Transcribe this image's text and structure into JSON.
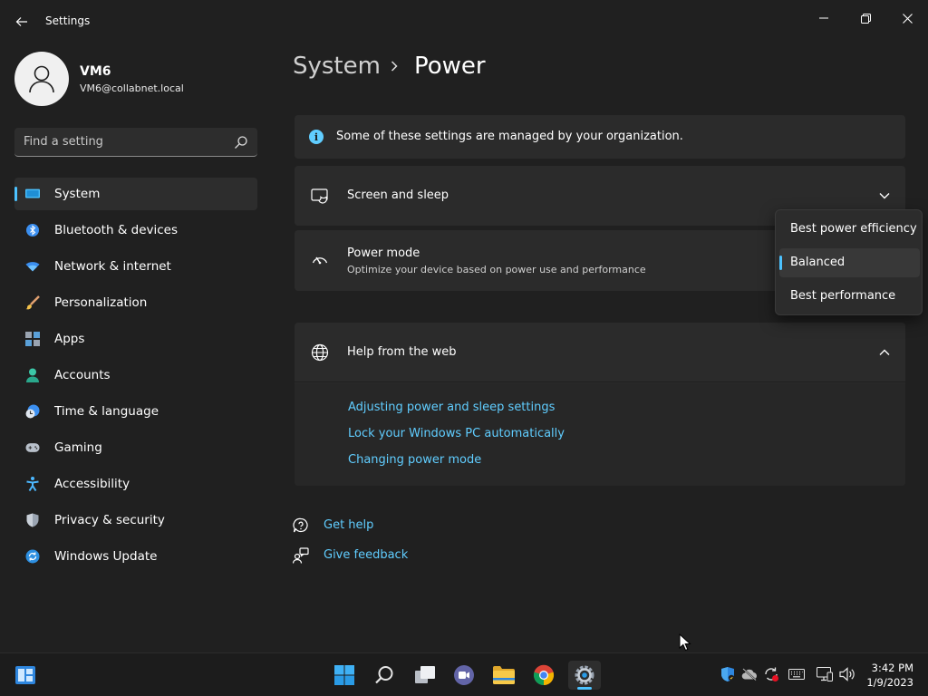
{
  "window": {
    "title": "Settings"
  },
  "profile": {
    "name": "VM6",
    "email": "VM6@collabnet.local"
  },
  "search": {
    "placeholder": "Find a setting"
  },
  "sidebar": {
    "items": [
      {
        "label": "System",
        "icon": "system-icon",
        "active": true
      },
      {
        "label": "Bluetooth & devices",
        "icon": "bluetooth-icon"
      },
      {
        "label": "Network & internet",
        "icon": "wifi-icon"
      },
      {
        "label": "Personalization",
        "icon": "brush-icon"
      },
      {
        "label": "Apps",
        "icon": "apps-icon"
      },
      {
        "label": "Accounts",
        "icon": "accounts-icon"
      },
      {
        "label": "Time & language",
        "icon": "clock-globe-icon"
      },
      {
        "label": "Gaming",
        "icon": "gamepad-icon"
      },
      {
        "label": "Accessibility",
        "icon": "accessibility-icon"
      },
      {
        "label": "Privacy & security",
        "icon": "shield-icon"
      },
      {
        "label": "Windows Update",
        "icon": "update-icon"
      }
    ]
  },
  "breadcrumb": {
    "parent": "System",
    "current": "Power"
  },
  "info_banner": {
    "text": "Some of these settings are managed by your organization."
  },
  "screen_sleep": {
    "title": "Screen and sleep"
  },
  "power_mode": {
    "title": "Power mode",
    "description": "Optimize your device based on power use and performance",
    "options": [
      "Best power efficiency",
      "Balanced",
      "Best performance"
    ],
    "selected": "Balanced"
  },
  "help_web": {
    "title": "Help from the web",
    "links": [
      "Adjusting power and sleep settings",
      "Lock your Windows PC automatically",
      "Changing power mode"
    ]
  },
  "help_links": {
    "get_help": "Get help",
    "give_feedback": "Give feedback"
  },
  "taskbar": {
    "apps": [
      "start-icon",
      "search-icon",
      "task-view-icon",
      "chat-icon",
      "file-explorer-icon",
      "chrome-icon",
      "settings-icon"
    ],
    "tray": [
      "defender-icon",
      "cloud-offline-icon",
      "sync-icon",
      "keyboard-icon",
      "display-icon",
      "volume-icon"
    ],
    "time": "3:42 PM",
    "date": "1/9/2023"
  },
  "colors": {
    "accent": "#4cc2ff",
    "link": "#60cdff",
    "background": "#202020",
    "card": "#2b2b2b"
  }
}
